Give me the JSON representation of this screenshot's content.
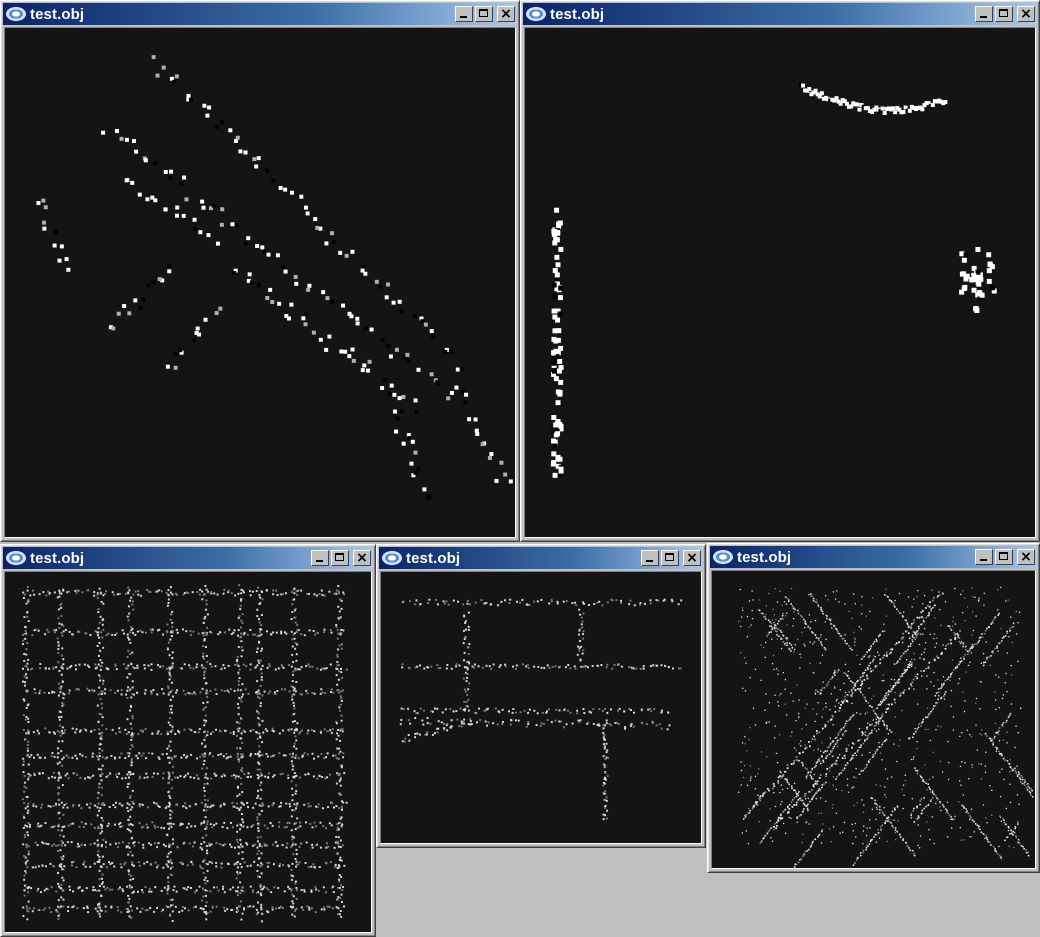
{
  "windows": [
    {
      "id": "w1",
      "title": "test.obj",
      "buttons": {
        "minimize": "minimize-icon",
        "maximize": "maximize-icon",
        "close": "close-icon"
      },
      "view": "point-cloud-diagonal-tree-rows"
    },
    {
      "id": "w2",
      "title": "test.obj",
      "buttons": {
        "minimize": "minimize-icon",
        "maximize": "maximize-icon",
        "close": "close-icon"
      },
      "view": "point-cloud-segments"
    },
    {
      "id": "w3",
      "title": "test.obj",
      "buttons": {
        "minimize": "minimize-icon",
        "maximize": "maximize-icon",
        "close": "close-icon"
      },
      "view": "point-cloud-city-grid"
    },
    {
      "id": "w4",
      "title": "test.obj",
      "buttons": {
        "minimize": "minimize-icon",
        "maximize": "maximize-icon",
        "close": "close-icon"
      },
      "view": "point-cloud-road-network"
    },
    {
      "id": "w5",
      "title": "test.obj",
      "buttons": {
        "minimize": "minimize-icon",
        "maximize": "maximize-icon",
        "close": "close-icon"
      },
      "view": "point-cloud-diagonal-city"
    }
  ],
  "colors": {
    "canvas_bg": "#141414",
    "point": "#ffffff",
    "point_dim": "#b0b0b0",
    "point_dark": "#000000",
    "desktop": "#c0c0c0",
    "title_start": "#0a246a",
    "title_end": "#a6caf0"
  }
}
